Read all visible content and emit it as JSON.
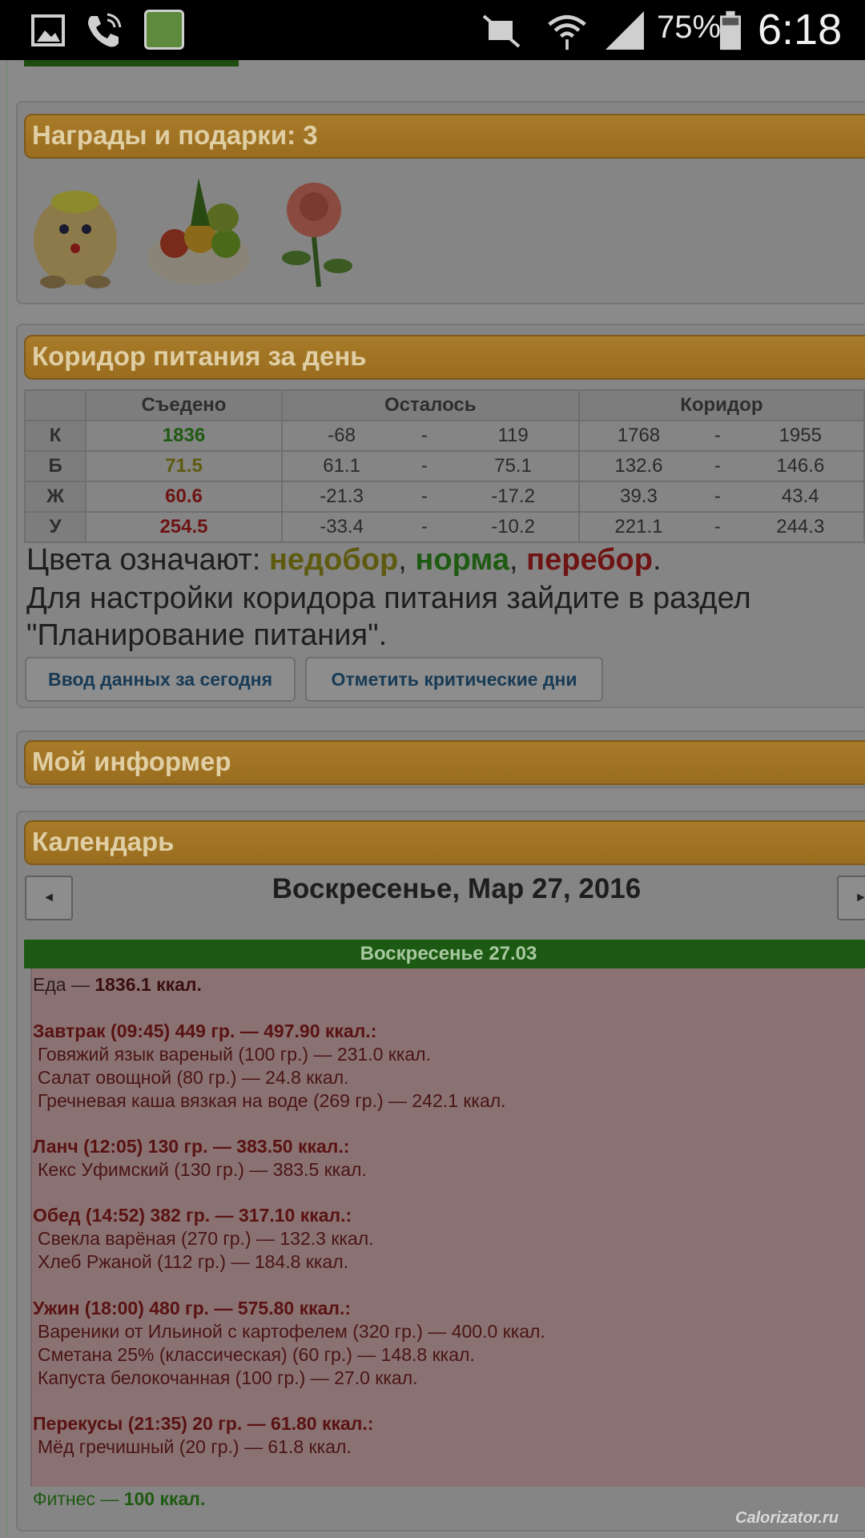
{
  "status_bar": {
    "battery_percent": "75%",
    "time": "6:18",
    "icons": [
      "gallery-icon",
      "phone-call-icon",
      "app-notification-icon",
      "mute-icon",
      "wifi-icon",
      "signal-icon",
      "battery-icon"
    ]
  },
  "awards": {
    "title": "Награды и подарки: 3",
    "items": [
      "straw-doll-gift",
      "fruit-salad-gift",
      "rose-gift"
    ]
  },
  "nutrition": {
    "title": "Коридор питания за день",
    "headers": {
      "eaten": "Съедено",
      "remaining": "Осталось",
      "corridor": "Коридор"
    },
    "rows": [
      {
        "label": "К",
        "eaten": "1836",
        "rem_min": "-68",
        "rem_max": "119",
        "cor_min": "1768",
        "cor_max": "1955",
        "dash": "-"
      },
      {
        "label": "Б",
        "eaten": "71.5",
        "rem_min": "61.1",
        "rem_max": "75.1",
        "cor_min": "132.6",
        "cor_max": "146.6",
        "dash": "-"
      },
      {
        "label": "Ж",
        "eaten": "60.6",
        "rem_min": "-21.3",
        "rem_max": "-17.2",
        "cor_min": "39.3",
        "cor_max": "43.4",
        "dash": "-"
      },
      {
        "label": "У",
        "eaten": "254.5",
        "rem_min": "-33.4",
        "rem_max": "-10.2",
        "cor_min": "221.1",
        "cor_max": "244.3",
        "dash": "-"
      }
    ],
    "legend_prefix": "Цвета означают: ",
    "legend_under": "недобор",
    "legend_norm": "норма",
    "legend_over": "перебор",
    "legend_sep": ", ",
    "legend_end": ".",
    "note": "Для настройки коридора питания зайдите в раздел \"Планирование питания\".",
    "btn_input": "Ввод данных за сегодня",
    "btn_critical": "Отметить критические дни"
  },
  "informer": {
    "title": "Мой информер"
  },
  "calendar": {
    "title": "Календарь",
    "prev": "◄",
    "next": "►",
    "date": "Воскресенье, Мар 27, 2016",
    "day_header": "Воскресенье 27.03",
    "food_total_label": "Еда — ",
    "food_total_value": "1836.1 ккал.",
    "meals": [
      {
        "title": "Завтрак (09:45) 449 гр. — 497.90 ккал.:",
        "items": [
          "Говяжий язык вареный (100 гр.) — 231.0 ккал.",
          "Салат овощной (80 гр.) — 24.8 ккал.",
          "Гречневая каша вязкая на воде (269 гр.) — 242.1 ккал."
        ]
      },
      {
        "title": "Ланч (12:05) 130 гр. — 383.50 ккал.:",
        "items": [
          "Кекс Уфимский (130 гр.) — 383.5 ккал."
        ]
      },
      {
        "title": "Обед (14:52) 382 гр. — 317.10 ккал.:",
        "items": [
          "Свекла варёная (270 гр.) — 132.3 ккал.",
          "Хлеб Ржаной (112 гр.) — 184.8 ккал."
        ]
      },
      {
        "title": "Ужин (18:00) 480 гр. — 575.80 ккал.:",
        "items": [
          "Вареники от Ильиной с картофелем (320 гр.) — 400.0 ккал.",
          "Сметана 25% (классическая) (60 гр.) — 148.8 ккал.",
          "Капуста белокочанная (100 гр.) — 27.0 ккал."
        ]
      },
      {
        "title": "Перекусы (21:35) 20 гр. — 61.80 ккал.:",
        "items": [
          "Мёд гречишный (20 гр.) — 61.8 ккал."
        ]
      }
    ],
    "fitness_label": "Фитнес — ",
    "fitness_value": "100 ккал."
  },
  "watermark": "Calorizator.ru"
}
